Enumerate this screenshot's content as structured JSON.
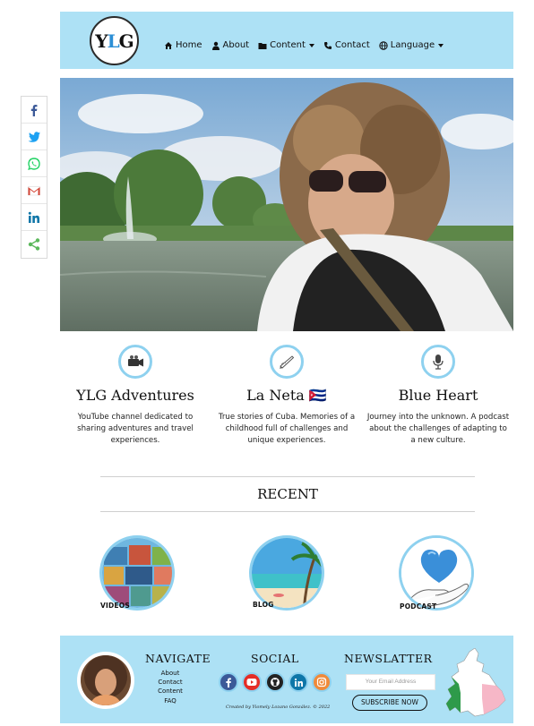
{
  "header": {
    "logo_text_a": "Y",
    "logo_text_b": "L",
    "logo_text_c": "G",
    "nav": [
      {
        "label": "Home",
        "icon": "home-icon"
      },
      {
        "label": "About",
        "icon": "user-icon"
      },
      {
        "label": "Content",
        "icon": "folder-icon",
        "dropdown": true
      },
      {
        "label": "Contact",
        "icon": "phone-icon"
      },
      {
        "label": "Language",
        "icon": "globe-icon",
        "dropdown": true
      }
    ]
  },
  "share": [
    "facebook-icon",
    "twitter-icon",
    "whatsapp-icon",
    "gmail-icon",
    "linkedin-icon",
    "share-icon"
  ],
  "features": [
    {
      "title": "YLG Adventures",
      "text": "YouTube channel dedicated to sharing adventures and travel experiences.",
      "icon": "video-camera-icon"
    },
    {
      "title": "La Neta 🇨🇺",
      "text": "True stories of Cuba. Memories of a childhood full of challenges and unique experiences.",
      "icon": "pen-writing-icon"
    },
    {
      "title": "Blue Heart",
      "text": "Journey into the unknown. A podcast about the challenges of adapting to a new culture.",
      "icon": "microphone-icon"
    }
  ],
  "recent": {
    "title": "RECENT",
    "tiles": [
      {
        "label": "VIDEOS"
      },
      {
        "label": "BLOG"
      },
      {
        "label": "PODCAST"
      }
    ]
  },
  "footer": {
    "navigate_title": "NAVIGATE",
    "links": [
      "About",
      "Contact",
      "Content",
      "FAQ"
    ],
    "social_title": "SOCIAL",
    "newsletter_title": "NEWSLATTER",
    "email_placeholder": "Your Email Address",
    "subscribe_label": "SUBSCRIBE NOW",
    "credit": "Created by Yiomely Lozano González. © 2022"
  },
  "colors": {
    "accent": "#ade1f5",
    "ring": "#8ed1ef"
  }
}
